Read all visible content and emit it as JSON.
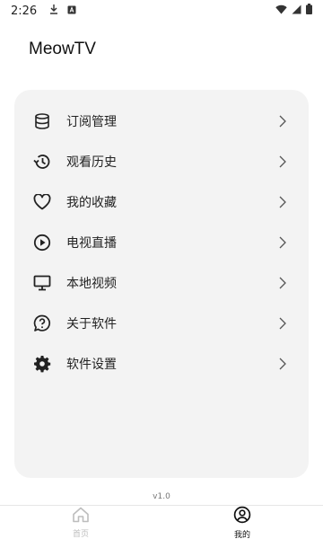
{
  "status_bar": {
    "time": "2:26",
    "left_icons": [
      "download-icon",
      "app-notification-icon"
    ],
    "right_icons": [
      "wifi-icon",
      "cell-signal-icon",
      "battery-icon"
    ]
  },
  "app": {
    "title": "MeowTV"
  },
  "menu": {
    "items": [
      {
        "label": "订阅管理",
        "icon": "database-icon"
      },
      {
        "label": "观看历史",
        "icon": "history-icon"
      },
      {
        "label": "我的收藏",
        "icon": "heart-icon"
      },
      {
        "label": "电视直播",
        "icon": "play-circle-icon"
      },
      {
        "label": "本地视频",
        "icon": "monitor-icon"
      },
      {
        "label": "关于软件",
        "icon": "help-bubble-icon"
      },
      {
        "label": "软件设置",
        "icon": "gear-icon"
      }
    ]
  },
  "footer": {
    "version": "v1.0"
  },
  "bottom_nav": {
    "tabs": [
      {
        "label": "首页",
        "icon": "home-icon",
        "active": false
      },
      {
        "label": "我的",
        "icon": "user-circle-icon",
        "active": true
      }
    ]
  },
  "colors": {
    "card_background": "#f3f3f3",
    "active_tab": "#111111",
    "inactive_tab": "#bdbdbd"
  }
}
